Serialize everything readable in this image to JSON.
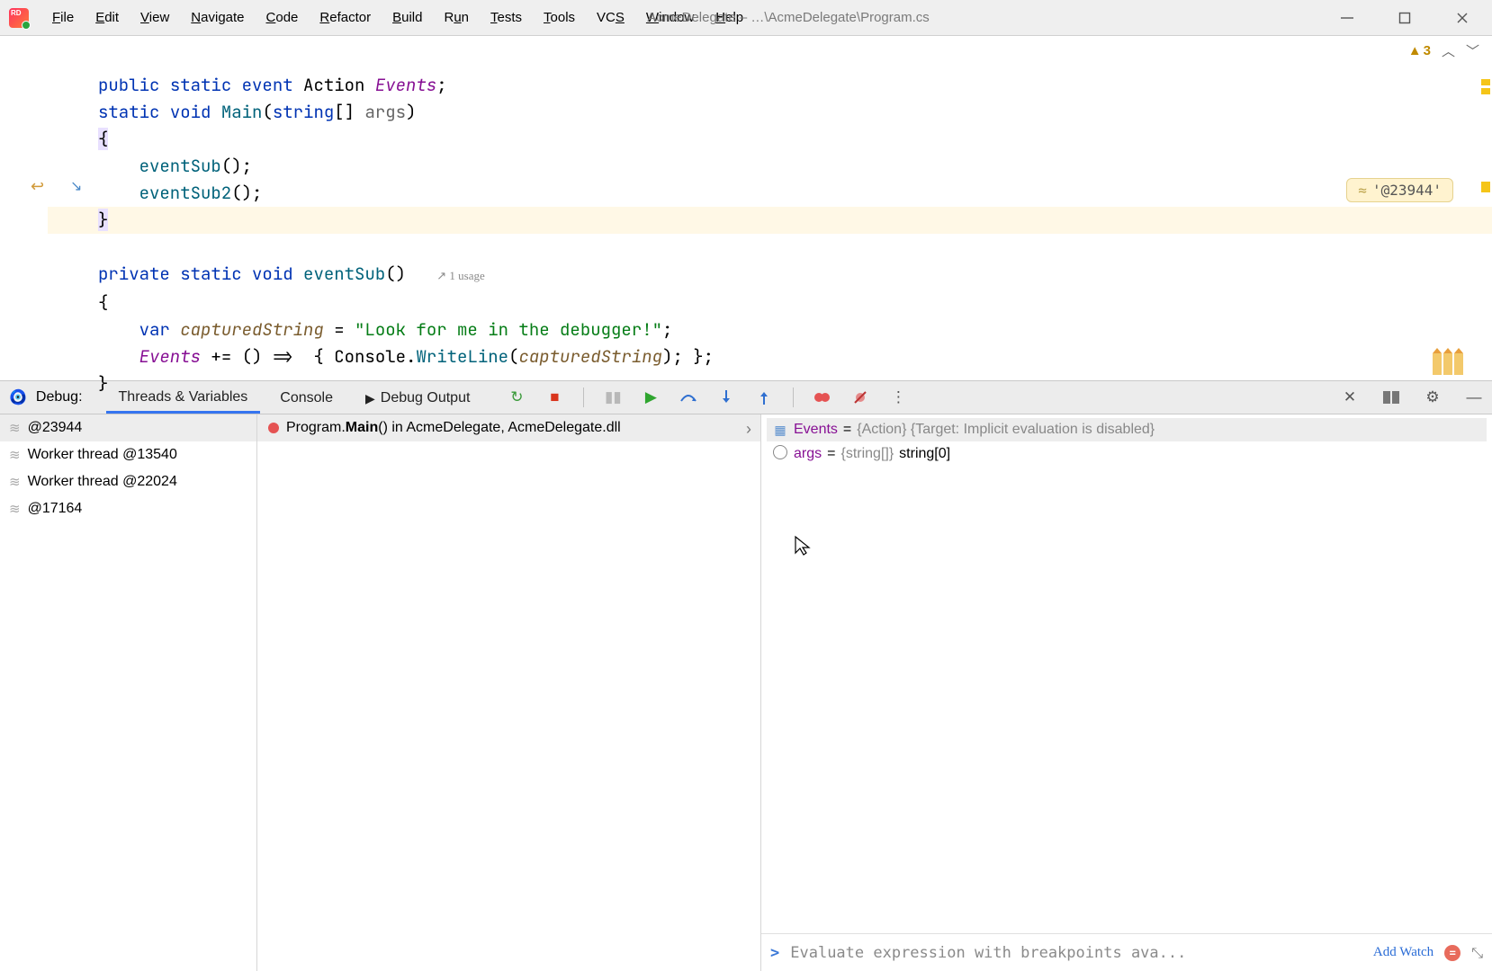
{
  "window": {
    "title": "AcmeDelegate – …\\AcmeDelegate\\Program.cs"
  },
  "menubar": {
    "items": [
      {
        "label": "File",
        "u": "F"
      },
      {
        "label": "Edit",
        "u": "E"
      },
      {
        "label": "View",
        "u": "V"
      },
      {
        "label": "Navigate",
        "u": "N"
      },
      {
        "label": "Code",
        "u": "C"
      },
      {
        "label": "Refactor",
        "u": "R"
      },
      {
        "label": "Build",
        "u": "B"
      },
      {
        "label": "Run",
        "u": "u"
      },
      {
        "label": "Tests",
        "u": "T"
      },
      {
        "label": "Tools",
        "u": "T"
      },
      {
        "label": "VCS",
        "u": "S"
      },
      {
        "label": "Window",
        "u": "W"
      },
      {
        "label": "Help",
        "u": "H"
      }
    ]
  },
  "editor": {
    "warnings": "3",
    "inlay": "'@23944'",
    "usage": "1 usage",
    "code_tokens": {
      "l1": {
        "a": "public",
        "b": "static",
        "c": "event",
        "d": "Action",
        "e": "Events",
        "semi": ";"
      },
      "l2": {
        "a": "static",
        "b": "void",
        "c": "Main",
        "paren_open": "(",
        "d": "string",
        "brack": "[]",
        "e": "args",
        "paren_close": ")"
      },
      "l3": {
        "brace": "{"
      },
      "l4": {
        "a": "eventSub",
        "call": "();"
      },
      "l5": {
        "a": "eventSub2",
        "call": "();"
      },
      "l6": {
        "brace": "}"
      },
      "l7": {
        "a": "private",
        "b": "static",
        "c": "void",
        "d": "eventSub",
        "paren": "()"
      },
      "l8": {
        "brace": "{"
      },
      "l9": {
        "a": "var",
        "b": "capturedString",
        "eq": " = ",
        "str": "\"Look for me in the debugger!\"",
        "semi": ";"
      },
      "l10": {
        "a": "Events",
        "op": " += () =>  { ",
        "b": "Console",
        "dot": ".",
        "c": "WriteLine",
        "open": "(",
        "d": "capturedString",
        "close": "); };"
      },
      "l11": {
        "brace": "}"
      }
    }
  },
  "debug": {
    "title": "Debug:",
    "tabs": {
      "threads": "Threads & Variables",
      "console": "Console",
      "output": "Debug Output"
    },
    "threads": [
      {
        "name": "@23944",
        "active": true
      },
      {
        "name": "Worker thread @13540",
        "active": false
      },
      {
        "name": "Worker thread @22024",
        "active": false
      },
      {
        "name": "@17164",
        "active": false
      }
    ],
    "frame": {
      "prefix": "Program.",
      "method": "Main",
      "suffix": "() in AcmeDelegate, AcmeDelegate.dll"
    },
    "vars": [
      {
        "name": "Events",
        "eq": " = ",
        "tval": "{Action} {Target: Implicit evaluation is disabled}",
        "plain": "",
        "sel": true,
        "icon": "grid"
      },
      {
        "name": "args",
        "eq": " = ",
        "tval": "{string[]} ",
        "plain": "string[0]",
        "sel": false,
        "icon": "obj"
      }
    ],
    "eval_placeholder": "Evaluate expression with breakpoints ava...",
    "add_watch": "Add Watch"
  }
}
